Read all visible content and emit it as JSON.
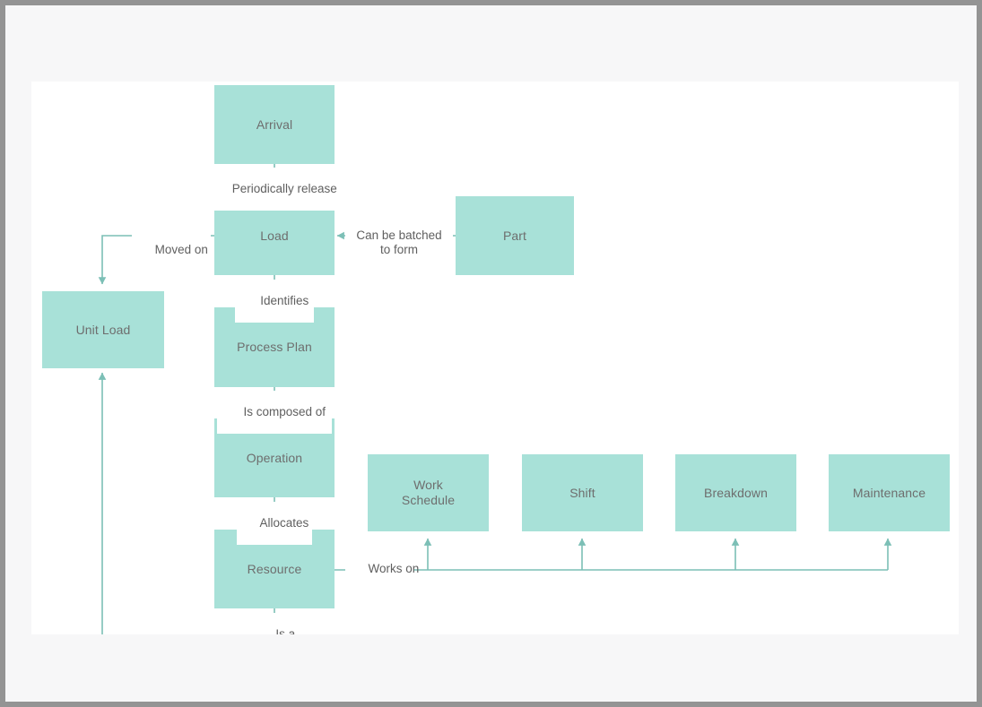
{
  "canvas": {
    "background": "#ffffff",
    "page_background": "#f7f7f8",
    "border_color": "#949494"
  },
  "theme": {
    "node_fill": "#a8e1d8",
    "node_text": "#6e6e6e",
    "edge_line": "#7cbfb6",
    "edge_label_text": "#5f5f5f"
  },
  "diagram": {
    "type": "entity-relationship-flow",
    "nodes": [
      {
        "id": "arrival",
        "label": "Arrival"
      },
      {
        "id": "load",
        "label": "Load"
      },
      {
        "id": "part",
        "label": "Part"
      },
      {
        "id": "unit-load",
        "label": "Unit Load"
      },
      {
        "id": "process-plan",
        "label": "Process Plan"
      },
      {
        "id": "operation",
        "label": "Operation"
      },
      {
        "id": "resource",
        "label": "Resource"
      },
      {
        "id": "work-schedule",
        "label": "Work\nSchedule"
      },
      {
        "id": "shift",
        "label": "Shift"
      },
      {
        "id": "breakdown",
        "label": "Breakdown"
      },
      {
        "id": "maintenance",
        "label": "Maintenance"
      }
    ],
    "edges": [
      {
        "id": "arrival-load",
        "from": "arrival",
        "to": "load",
        "label": "Periodically release"
      },
      {
        "id": "part-load",
        "from": "part",
        "to": "load",
        "label": "Can be batched\nto form"
      },
      {
        "id": "load-unitload",
        "from": "load",
        "to": "unit-load",
        "label": "Moved on"
      },
      {
        "id": "load-processplan",
        "from": "load",
        "to": "process-plan",
        "label": "Identifies"
      },
      {
        "id": "processplan-operation",
        "from": "process-plan",
        "to": "operation",
        "label": "Is composed of"
      },
      {
        "id": "operation-resource",
        "from": "operation",
        "to": "resource",
        "label": "Allocates"
      },
      {
        "id": "resource-schedules",
        "from": "resource",
        "to": "work-schedule",
        "label": "Works on"
      },
      {
        "id": "resource-isa",
        "from": "resource",
        "to": "",
        "label": "Is a"
      }
    ]
  }
}
